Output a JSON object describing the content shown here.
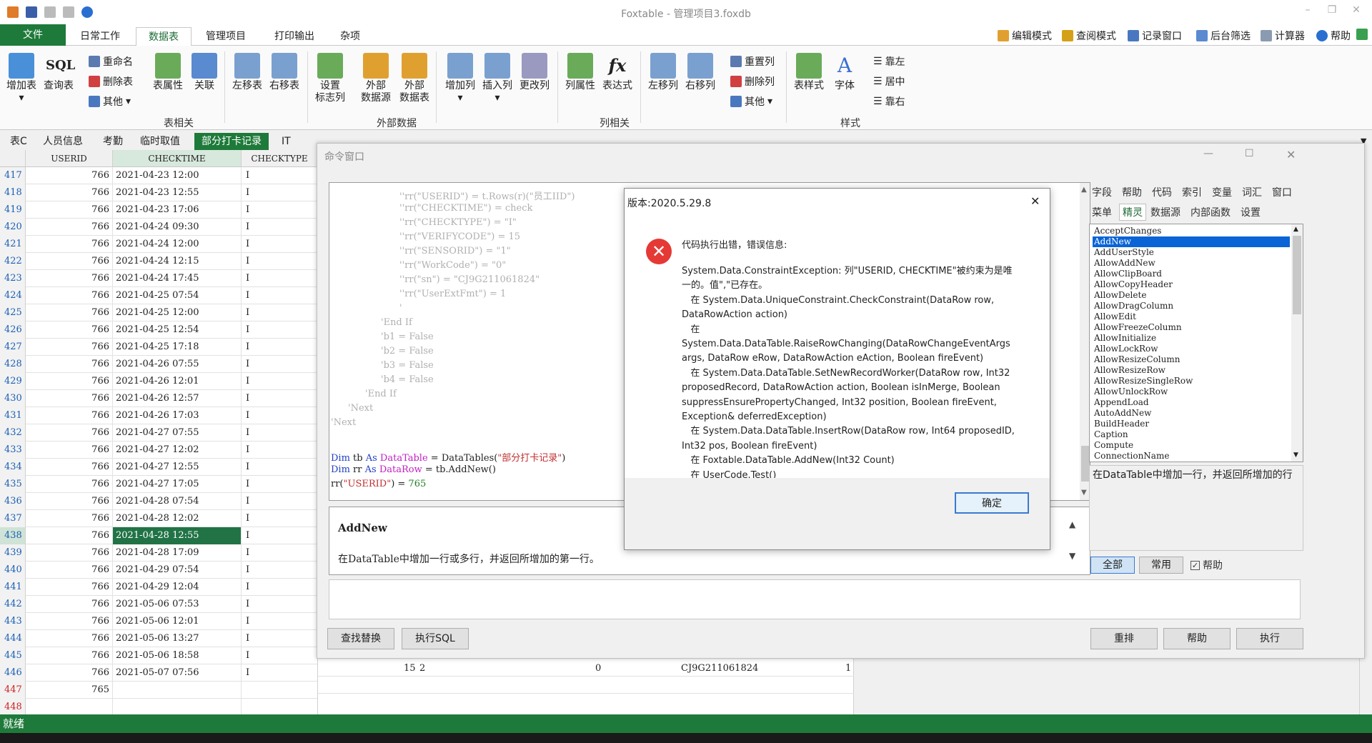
{
  "window": {
    "title": "Foxtable - 管理项目3.foxdb"
  },
  "menu": {
    "tabs": [
      "文件",
      "日常工作",
      "数据表",
      "管理项目",
      "打印输出",
      "杂项"
    ],
    "right_tools": [
      "编辑模式",
      "查阅模式",
      "记录窗口",
      "后台筛选",
      "计算器",
      "帮助"
    ]
  },
  "ribbon": {
    "buttons": {
      "add_table": "增加表",
      "sql_query": "查询表",
      "rename": "重命名",
      "delete_table": "删除表",
      "other1": "其他",
      "table_props": "表属性",
      "relation": "关联",
      "move_left": "左移表",
      "move_right": "右移表",
      "set_flag": "设置",
      "set_flag2": "标志列",
      "ext_source": "外部",
      "ext_source2": "数据源",
      "ext_table": "外部",
      "ext_table2": "数据表",
      "add_col": "增加列",
      "insert_col": "插入列",
      "change_col": "更改列",
      "col_props": "列属性",
      "expression": "表达式",
      "fx": "fx",
      "col_left": "左移列",
      "col_right": "右移列",
      "reset_col": "重置列",
      "delete_col": "删除列",
      "other2": "其他",
      "table_style": "表样式",
      "font": "字体",
      "align_left": "靠左",
      "align_center": "居中",
      "align_right": "靠右",
      "sql_icon": "SQL"
    },
    "groups": {
      "table": "表相关",
      "external": "外部数据",
      "column": "列相关",
      "style": "样式"
    }
  },
  "table_tabs": [
    "表C",
    "人员信息",
    "考勤",
    "临时取值",
    "部分打卡记录",
    "IT"
  ],
  "grid": {
    "headers": [
      "USERID",
      "CHECKTIME",
      "CHECKTYPE"
    ],
    "rows": [
      [
        "417",
        "766",
        "2021-04-23 12:00",
        "I"
      ],
      [
        "418",
        "766",
        "2021-04-23 12:55",
        "I"
      ],
      [
        "419",
        "766",
        "2021-04-23 17:06",
        "I"
      ],
      [
        "420",
        "766",
        "2021-04-24 09:30",
        "I"
      ],
      [
        "421",
        "766",
        "2021-04-24 12:00",
        "I"
      ],
      [
        "422",
        "766",
        "2021-04-24 12:15",
        "I"
      ],
      [
        "423",
        "766",
        "2021-04-24 17:45",
        "I"
      ],
      [
        "424",
        "766",
        "2021-04-25 07:54",
        "I"
      ],
      [
        "425",
        "766",
        "2021-04-25 12:00",
        "I"
      ],
      [
        "426",
        "766",
        "2021-04-25 12:54",
        "I"
      ],
      [
        "427",
        "766",
        "2021-04-25 17:18",
        "I"
      ],
      [
        "428",
        "766",
        "2021-04-26 07:55",
        "I"
      ],
      [
        "429",
        "766",
        "2021-04-26 12:01",
        "I"
      ],
      [
        "430",
        "766",
        "2021-04-26 12:57",
        "I"
      ],
      [
        "431",
        "766",
        "2021-04-26 17:03",
        "I"
      ],
      [
        "432",
        "766",
        "2021-04-27 07:55",
        "I"
      ],
      [
        "433",
        "766",
        "2021-04-27 12:02",
        "I"
      ],
      [
        "434",
        "766",
        "2021-04-27 12:55",
        "I"
      ],
      [
        "435",
        "766",
        "2021-04-27 17:05",
        "I"
      ],
      [
        "436",
        "766",
        "2021-04-28 07:54",
        "I"
      ],
      [
        "437",
        "766",
        "2021-04-28 12:02",
        "I"
      ],
      [
        "438",
        "766",
        "2021-04-28 12:55",
        "I"
      ],
      [
        "439",
        "766",
        "2021-04-28 17:09",
        "I"
      ],
      [
        "440",
        "766",
        "2021-04-29 07:54",
        "I"
      ],
      [
        "441",
        "766",
        "2021-04-29 12:04",
        "I"
      ],
      [
        "442",
        "766",
        "2021-05-06 07:53",
        "I"
      ],
      [
        "443",
        "766",
        "2021-05-06 12:01",
        "I"
      ],
      [
        "444",
        "766",
        "2021-05-06 13:27",
        "I"
      ],
      [
        "445",
        "766",
        "2021-05-06 18:58",
        "I"
      ],
      [
        "446",
        "766",
        "2021-05-07 07:56",
        "I"
      ],
      [
        "447",
        "765",
        "",
        ""
      ],
      [
        "448",
        "",
        "",
        ""
      ]
    ],
    "selected_row": "438",
    "row446_extra": [
      "15",
      "2",
      "0",
      "CJ9G211061824",
      "1"
    ]
  },
  "command_window": {
    "title": "命令窗口",
    "code_lines": [
      "''rr(\"USERID\") = t.Rows(r)(\"员工IID\")",
      "''rr(\"CHECKTIME\") = check",
      "''rr(\"CHECKTYPE\") = \"I\"",
      "''rr(\"VERIFYCODE\") = 15",
      "''rr(\"SENSORID\") = \"1\"",
      "''rr(\"WorkCode\") = \"0\"",
      "''rr(\"sn\") = \"CJ9G211061824\"",
      "''rr(\"UserExtFmt\") = 1",
      "'",
      "'End If",
      "'b1 = False",
      "'b2 = False",
      "'b3 = False",
      "'b4 = False",
      "'End If",
      "'Next",
      "'Next"
    ],
    "code": {
      "dim": "Dim",
      "tb": " tb ",
      "as": "As",
      "datatable": " DataTable",
      "eq": " = ",
      "datatables": "DataTables(",
      "tname": "\"部分打卡记录\"",
      "close": ")",
      "rr": " rr ",
      "datarow": " DataRow",
      "addnew": " = tb.AddNew()",
      "rrpre": "rr(",
      "userid": "\"USERID\"",
      "rrpost": ") = ",
      "val": "765"
    },
    "help_title": "AddNew",
    "help_text": "在DataTable中增加一行或多行，并返回所增加的第一行。",
    "side_tabs_row1": [
      "字段",
      "帮助",
      "代码",
      "索引",
      "变量",
      "词汇",
      "窗口"
    ],
    "side_tabs_row2": [
      "菜单",
      "精灵",
      "数据源",
      "内部函数",
      "设置"
    ],
    "members": [
      "AcceptChanges",
      "AddNew",
      "AddUserStyle",
      "AllowAddNew",
      "AllowClipBoard",
      "AllowCopyHeader",
      "AllowDelete",
      "AllowDragColumn",
      "AllowEdit",
      "AllowFreezeColumn",
      "AllowInitialize",
      "AllowLockRow",
      "AllowResizeColumn",
      "AllowResizeRow",
      "AllowResizeSingleRow",
      "AllowUnlockRow",
      "AppendLoad",
      "AutoAddNew",
      "BuildHeader",
      "Caption",
      "Compute",
      "ConnectionName"
    ],
    "member_desc": "在DataTable中增加一行，并返回所增加的行",
    "filter_buttons": [
      "全部",
      "常用"
    ],
    "help_check": "帮助",
    "bottom_buttons": [
      "查找替换",
      "执行SQL",
      "重排",
      "帮助",
      "执行"
    ]
  },
  "error_dialog": {
    "title": "版本:2020.5.29.8",
    "heading": "代码执行出错，错误信息:",
    "lines": [
      "System.Data.ConstraintException: 列\"USERID, CHECKTIME\"被约束为是唯",
      "一的。值\",\"已存在。",
      "   在 System.Data.UniqueConstraint.CheckConstraint(DataRow row,",
      "DataRowAction action)",
      "   在",
      "System.Data.DataTable.RaiseRowChanging(DataRowChangeEventArgs",
      "args, DataRow eRow, DataRowAction eAction, Boolean fireEvent)",
      "   在 System.Data.DataTable.SetNewRecordWorker(DataRow row, Int32",
      "proposedRecord, DataRowAction action, Boolean isInMerge, Boolean",
      "suppressEnsurePropertyChanged, Int32 position, Boolean fireEvent,",
      "Exception& deferredException)",
      "   在 System.Data.DataTable.InsertRow(DataRow row, Int64 proposedID,",
      "Int32 pos, Boolean fireEvent)",
      "   在 Foxtable.DataTable.AddNew(Int32 Count)",
      "   在 UserCode.Test()"
    ],
    "ok": "确定"
  },
  "status": {
    "text": "就绪"
  },
  "colors": {
    "brand": "#1e7a3a",
    "selected_cell": "#217346",
    "error": "#e53935"
  }
}
